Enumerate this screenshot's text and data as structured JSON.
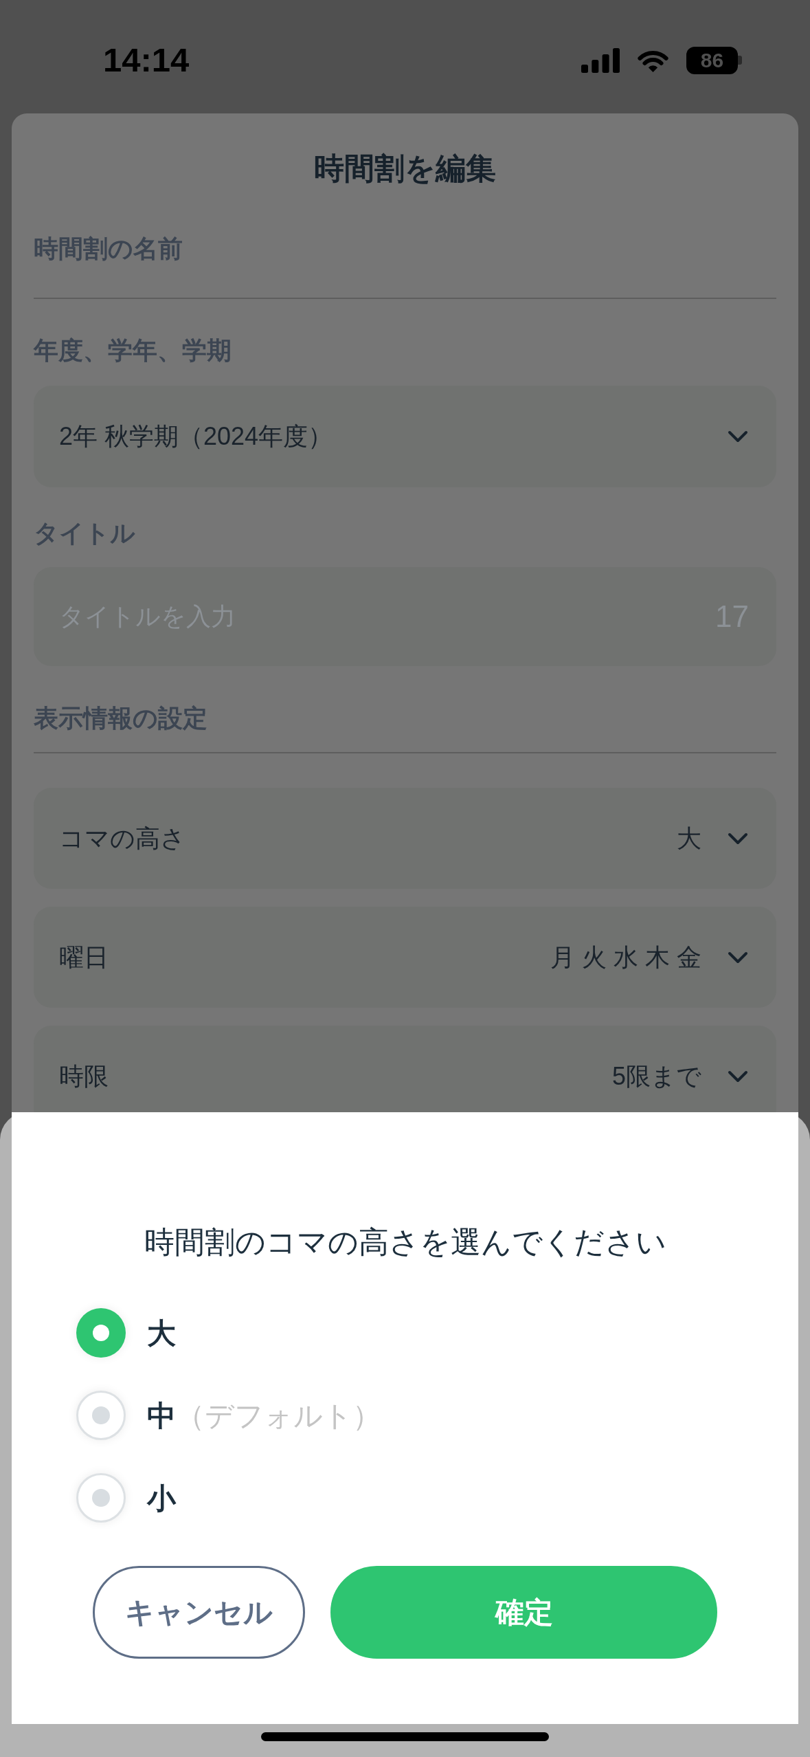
{
  "status_bar": {
    "time": "14:14",
    "battery": "86"
  },
  "screen": {
    "title": "時間割を編集"
  },
  "form": {
    "name_field": {
      "label": "時間割の名前"
    },
    "term_select": {
      "label": "年度、学年、学期",
      "value": "2年 秋学期（2024年度）"
    },
    "title_field": {
      "label": "タイトル",
      "placeholder": "タイトルを入力",
      "counter": "17"
    },
    "display_settings": {
      "heading": "表示情報の設定",
      "rows": [
        {
          "label": "コマの高さ",
          "value": "大"
        },
        {
          "label": "曜日",
          "value": "月 火 水 木 金"
        },
        {
          "label": "時限",
          "value": "5限まで"
        }
      ]
    }
  },
  "sheet": {
    "prompt": "時間割のコマの高さを選んでください",
    "options": [
      {
        "label": "大",
        "selected": true
      },
      {
        "label": "中",
        "note": "（デフォルト）",
        "selected": false
      },
      {
        "label": "小",
        "selected": false
      }
    ],
    "buttons": [
      {
        "label": "キャンセル",
        "kind": "secondary"
      },
      {
        "label": "確定",
        "kind": "primary"
      }
    ]
  }
}
